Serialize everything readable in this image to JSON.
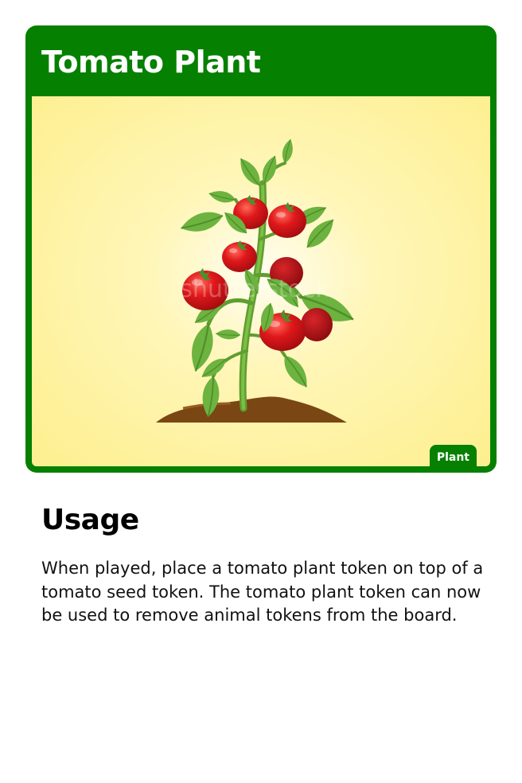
{
  "card": {
    "title": "Tomato Plant",
    "type_badge": "Plant",
    "illustration": "tomato-plant-illustration",
    "watermark": "shutterstock",
    "colors": {
      "frame": "#058000",
      "art_background": "#fdef8e",
      "tomato": "#e0181b",
      "leaf": "#6db33f",
      "soil": "#7a4614"
    }
  },
  "usage": {
    "heading": "Usage",
    "text": "When played, place a tomato plant token on top of a tomato seed token. The tomato plant token can now be used to remove animal tokens from the board."
  }
}
